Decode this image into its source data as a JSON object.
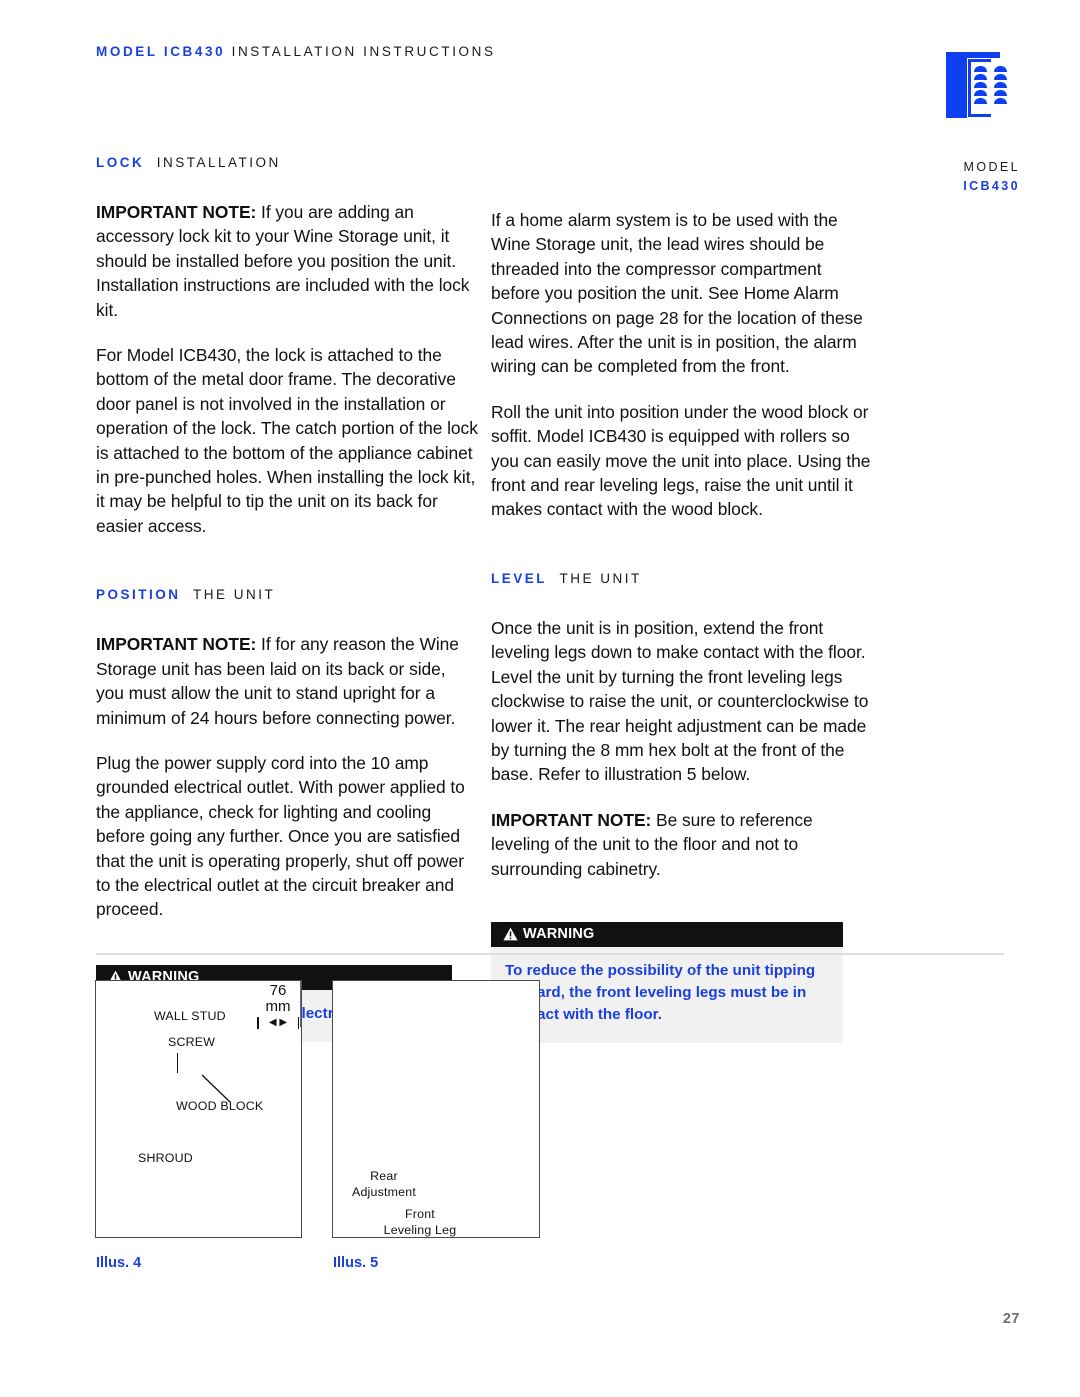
{
  "header": {
    "model_prefix": "MODEL ICB430",
    "title_rest": "INSTALLATION INSTRUCTIONS"
  },
  "logo": {
    "name": "wine-storage-unit-logo",
    "color": "#0e3ff0"
  },
  "sidebar": {
    "label_model": "MODEL",
    "label_value": "ICB430"
  },
  "colors": {
    "accent_blue": "#1a3fe0",
    "warning_bar": "#111111",
    "warning_body": "#f1f1f1",
    "divider": "#dedede",
    "page_number": "#6e6e6e"
  },
  "left_column": {
    "section1": {
      "heading_blue": "LOCK",
      "heading_black": "INSTALLATION",
      "paragraphs": [
        {
          "lead": "IMPORTANT NOTE:",
          "text": " If you are adding an accessory lock kit to your Wine Storage unit, it should be installed before you position the unit. Installation instructions are included with the lock kit."
        },
        {
          "lead": "",
          "text": "For Model ICB430, the lock is attached to the bottom of the metal door frame. The decorative door panel is not involved in the installation or operation of the lock. The catch portion of the lock is attached to the bottom of the appliance cabinet in pre-punched holes. When installing the lock kit, it may be helpful to tip the unit on its back for easier access."
        }
      ]
    },
    "section2": {
      "heading_blue": "POSITION",
      "heading_black": "THE UNIT",
      "paragraphs": [
        {
          "lead": "IMPORTANT NOTE:",
          "text": " If for any reason the Wine Storage unit has been laid on its back or side, you must allow the unit to stand upright for a minimum of 24 hours before connecting power."
        },
        {
          "lead": "",
          "text": "Plug the power supply cord into the 10 amp grounded electrical outlet. With power applied to the appliance, check for lighting and cooling before going any further. Once you are satisfied that the unit is operating properly, shut off power to the electrical outlet at the circuit breaker and proceed."
        }
      ],
      "warning": {
        "bar_label": "WARNING",
        "text": "Shut off the power to the electrical outlet."
      }
    }
  },
  "right_column": {
    "paragraphs": [
      {
        "lead": "",
        "text": "If a home alarm system is to be used with the Wine Storage unit, the lead wires should be threaded into the compressor compartment before you position the unit. See Home Alarm Connections on page 28 for the location of these lead wires. After the unit is in position, the alarm wiring can be completed from the front."
      },
      {
        "lead": "",
        "text": "Roll the unit into position under the wood block or soffit. Model ICB430 is equipped with rollers so you can easily move the unit into place. Using the front and rear leveling legs, raise the unit until it makes contact with the wood block."
      }
    ],
    "section": {
      "heading_blue": "LEVEL",
      "heading_black": "THE UNIT",
      "paragraphs": [
        {
          "lead": "",
          "text": "Once the unit is in position, extend the front leveling legs down to make contact with the floor. Level the unit by turning the front leveling legs clockwise to raise the unit, or counterclockwise to lower it. The rear height adjustment can be made by turning the 8 mm hex bolt at the front of the base. Refer to illustration 5 below."
        },
        {
          "lead": "IMPORTANT NOTE:",
          "text": " Be sure to reference leveling of the unit to the floor and not to surrounding cabinetry."
        }
      ],
      "warning": {
        "bar_label": "WARNING",
        "text": "To reduce the possibility of the unit tipping forward, the front leveling legs must be in contact with the floor."
      }
    }
  },
  "illustrations": [
    {
      "caption": "Illus. 4",
      "labels": {
        "wall_stud": "WALL STUD",
        "screw": "SCREW",
        "wood_block": "WOOD BLOCK",
        "shroud": "SHROUD"
      },
      "dimension": {
        "value": "76",
        "unit": "mm"
      }
    },
    {
      "caption": "Illus. 5",
      "labels": {
        "rear_line1": "Rear",
        "rear_line2": "Adjustment",
        "front_line1": "Front",
        "front_line2": "Leveling Leg"
      }
    }
  ],
  "footer": {
    "page_number": "27"
  }
}
